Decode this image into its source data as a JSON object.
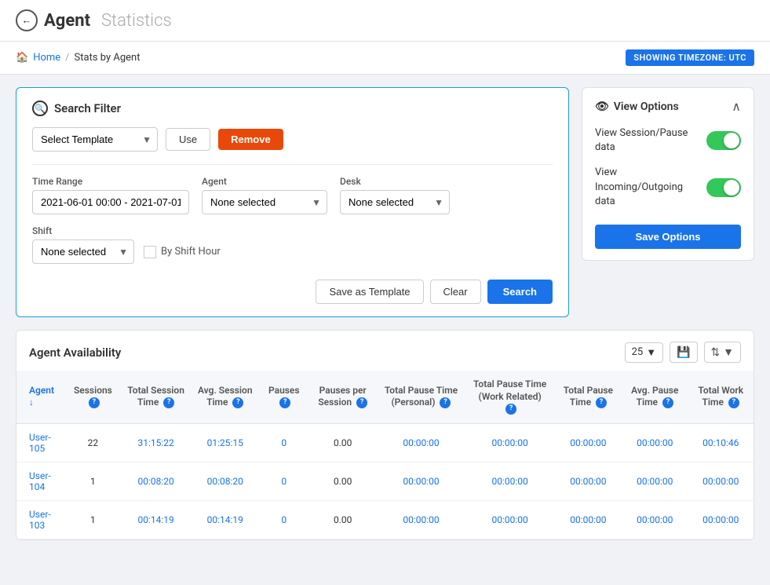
{
  "header": {
    "title_main": "Agent",
    "title_sub": "Statistics",
    "back_icon": "←"
  },
  "breadcrumb": {
    "home_label": "Home",
    "separator": "/",
    "current": "Stats by Agent",
    "timezone_badge": "SHOWING TIMEZONE: UTC"
  },
  "search_filter": {
    "title": "Search Filter",
    "template_placeholder": "Select Template",
    "btn_use": "Use",
    "btn_remove": "Remove",
    "time_range_label": "Time Range",
    "time_range_value": "2021-06-01 00:00 - 2021-07-01",
    "agent_label": "Agent",
    "agent_placeholder": "None selected",
    "desk_label": "Desk",
    "desk_placeholder": "None selected",
    "shift_label": "Shift",
    "shift_placeholder": "None selected",
    "by_shift_hour_label": "By Shift Hour",
    "btn_save_template": "Save as Template",
    "btn_clear": "Clear",
    "btn_search": "Search"
  },
  "view_options": {
    "title": "View Options",
    "eye_icon": "👁",
    "session_pause_label": "View Session/Pause data",
    "incoming_outgoing_label": "View Incoming/Outgoing data",
    "btn_save_options": "Save Options"
  },
  "availability": {
    "title": "Agent Availability",
    "page_size": "25",
    "columns": [
      {
        "key": "agent",
        "label": "Agent",
        "sortable": true,
        "help": false
      },
      {
        "key": "sessions",
        "label": "Sessions",
        "sortable": false,
        "help": true
      },
      {
        "key": "total_session_time",
        "label": "Total Session Time",
        "sortable": false,
        "help": true
      },
      {
        "key": "avg_session_time",
        "label": "Avg. Session Time",
        "sortable": false,
        "help": true
      },
      {
        "key": "pauses",
        "label": "Pauses",
        "sortable": false,
        "help": true
      },
      {
        "key": "pauses_per_session",
        "label": "Pauses per Session",
        "sortable": false,
        "help": true
      },
      {
        "key": "total_pause_time_personal",
        "label": "Total Pause Time (Personal)",
        "sortable": false,
        "help": true
      },
      {
        "key": "total_pause_time_work",
        "label": "Total Pause Time (Work Related)",
        "sortable": false,
        "help": true
      },
      {
        "key": "total_pause_time",
        "label": "Total Pause Time",
        "sortable": false,
        "help": true
      },
      {
        "key": "avg_pause_time",
        "label": "Avg. Pause Time",
        "sortable": false,
        "help": true
      },
      {
        "key": "total_work_time",
        "label": "Total Work Time",
        "sortable": false,
        "help": true
      }
    ],
    "rows": [
      {
        "agent": "User-105",
        "sessions": "22",
        "total_session_time": "31:15:22",
        "avg_session_time": "01:25:15",
        "pauses": "0",
        "pauses_per_session": "0.00",
        "total_pause_time_personal": "00:00:00",
        "total_pause_time_work": "00:00:00",
        "total_pause_time": "00:00:00",
        "avg_pause_time": "00:00:00",
        "total_work_time": "00:10:46"
      },
      {
        "agent": "User-104",
        "sessions": "1",
        "total_session_time": "00:08:20",
        "avg_session_time": "00:08:20",
        "pauses": "0",
        "pauses_per_session": "0.00",
        "total_pause_time_personal": "00:00:00",
        "total_pause_time_work": "00:00:00",
        "total_pause_time": "00:00:00",
        "avg_pause_time": "00:00:00",
        "total_work_time": "00:00:00"
      },
      {
        "agent": "User-103",
        "sessions": "1",
        "total_session_time": "00:14:19",
        "avg_session_time": "00:14:19",
        "pauses": "0",
        "pauses_per_session": "0.00",
        "total_pause_time_personal": "00:00:00",
        "total_pause_time_work": "00:00:00",
        "total_pause_time": "00:00:00",
        "avg_pause_time": "00:00:00",
        "total_work_time": "00:00:00"
      }
    ]
  }
}
